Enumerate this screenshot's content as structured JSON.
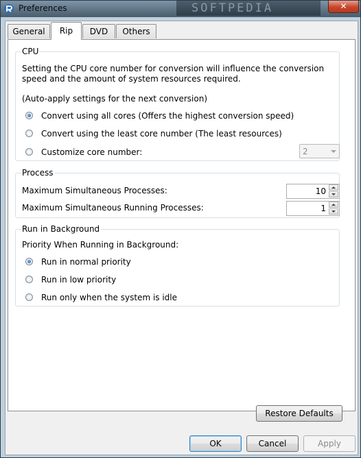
{
  "window": {
    "title": "Preferences",
    "close_label": "✕",
    "watermark": "SOFTPEDIA"
  },
  "tabs": [
    {
      "label": "General",
      "active": false
    },
    {
      "label": "Rip",
      "active": true
    },
    {
      "label": "DVD",
      "active": false
    },
    {
      "label": "Others",
      "active": false
    }
  ],
  "cpu": {
    "label": "CPU",
    "description": "Setting the CPU core number for conversion will influence the conversion speed and the amount of system resources required.",
    "note": "(Auto-apply settings for the next conversion)",
    "options": [
      {
        "label": "Convert using all cores (Offers the highest conversion speed)",
        "checked": true
      },
      {
        "label": "Convert using the least core number (The least resources)",
        "checked": false
      },
      {
        "label": "Customize core number:",
        "checked": false
      }
    ],
    "core_number": "2"
  },
  "process": {
    "label": "Process",
    "max_processes_label": "Maximum Simultaneous Processes:",
    "max_processes_value": "10",
    "max_running_label": "Maximum Simultaneous Running Processes:",
    "max_running_value": "1"
  },
  "background": {
    "label": "Run in Background",
    "priority_label": "Priority When Running in Background:",
    "options": [
      {
        "label": "Run in normal priority",
        "checked": true
      },
      {
        "label": "Run in low priority",
        "checked": false
      },
      {
        "label": "Run only when the system is idle",
        "checked": false
      }
    ]
  },
  "buttons": {
    "restore_defaults": "Restore Defaults",
    "ok": "OK",
    "cancel": "Cancel",
    "apply": "Apply"
  }
}
